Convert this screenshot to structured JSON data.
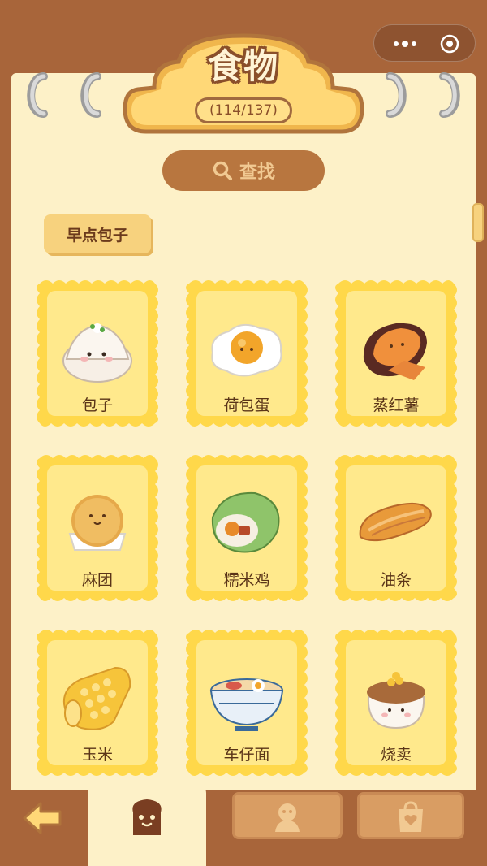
{
  "title": "食物",
  "progress": "(114/137)",
  "search": {
    "label": "查找"
  },
  "category": {
    "label": "早点包子"
  },
  "items": [
    {
      "label": "包子",
      "icon": "baozi-icon"
    },
    {
      "label": "荷包蛋",
      "icon": "fried-egg-icon"
    },
    {
      "label": "蒸红薯",
      "icon": "sweet-potato-icon"
    },
    {
      "label": "麻团",
      "icon": "sesame-ball-icon"
    },
    {
      "label": "糯米鸡",
      "icon": "lotus-rice-icon"
    },
    {
      "label": "油条",
      "icon": "youtiao-icon"
    },
    {
      "label": "玉米",
      "icon": "corn-icon"
    },
    {
      "label": "车仔面",
      "icon": "noodle-bowl-icon"
    },
    {
      "label": "烧卖",
      "icon": "shumai-icon"
    }
  ],
  "tabs": [
    {
      "name": "food",
      "icon": "toast-icon",
      "active": true
    },
    {
      "name": "characters",
      "icon": "character-icon",
      "active": false
    },
    {
      "name": "bag",
      "icon": "bag-icon",
      "active": false
    }
  ],
  "colors": {
    "brown": "#a8653a",
    "paper": "#fdf1c8",
    "card": "#ffe06a",
    "accent": "#f7d27e"
  }
}
